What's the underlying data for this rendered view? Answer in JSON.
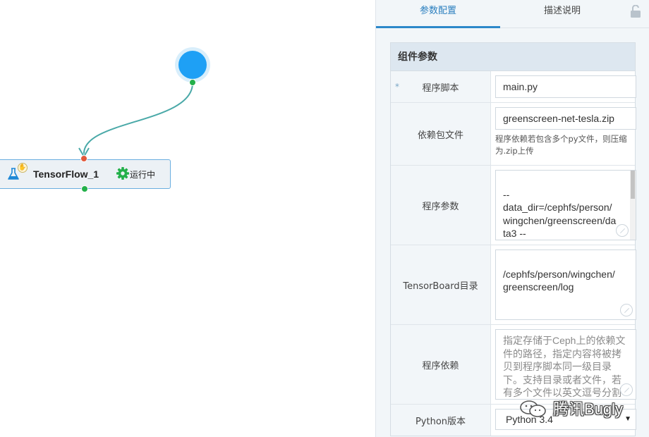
{
  "canvas": {
    "node": {
      "name": "TensorFlow_1",
      "status": "运行中",
      "icon": "flask-icon",
      "status_icon": "gear-icon",
      "status_color": "#23b04a"
    },
    "start_node_color": "#1ea0f5",
    "edge_color": "#4aa9a8"
  },
  "panel": {
    "tabs": [
      "参数配置",
      "描述说明"
    ],
    "active_tab": "参数配置",
    "lock_icon": "unlock-icon",
    "section_title": "组件参数",
    "fields": {
      "script": {
        "required_mark": "*",
        "label": "程序脚本",
        "value": "main.py"
      },
      "deps": {
        "label": "依赖包文件",
        "value": "greenscreen-net-tesla.zip",
        "hint": "程序依赖若包含多个py文件，则压缩为.zip上传"
      },
      "args": {
        "label": "程序参数",
        "value": "--\ndata_dir=/cephfs/person/\nwingchen/greenscreen/da\nta3 --\nout_model_dir=/cephfs/p"
      },
      "tensorboard": {
        "label": "TensorBoard目录",
        "value": "/cephfs/person/wingchen/\ngreenscreen/log"
      },
      "dependency": {
        "label": "程序依赖",
        "placeholder": "指定存储于Ceph上的依赖文件的路径，指定内容将被拷贝到程序脚本同一级目录下。支持目录或者文件，若有多个文件以英文逗号分割"
      },
      "python": {
        "label": "Python版本",
        "value": "Python 3.4"
      }
    },
    "accent_color": "#2c88c9"
  },
  "watermark": {
    "text": "腾讯Bugly",
    "icon": "wechat-icon"
  }
}
